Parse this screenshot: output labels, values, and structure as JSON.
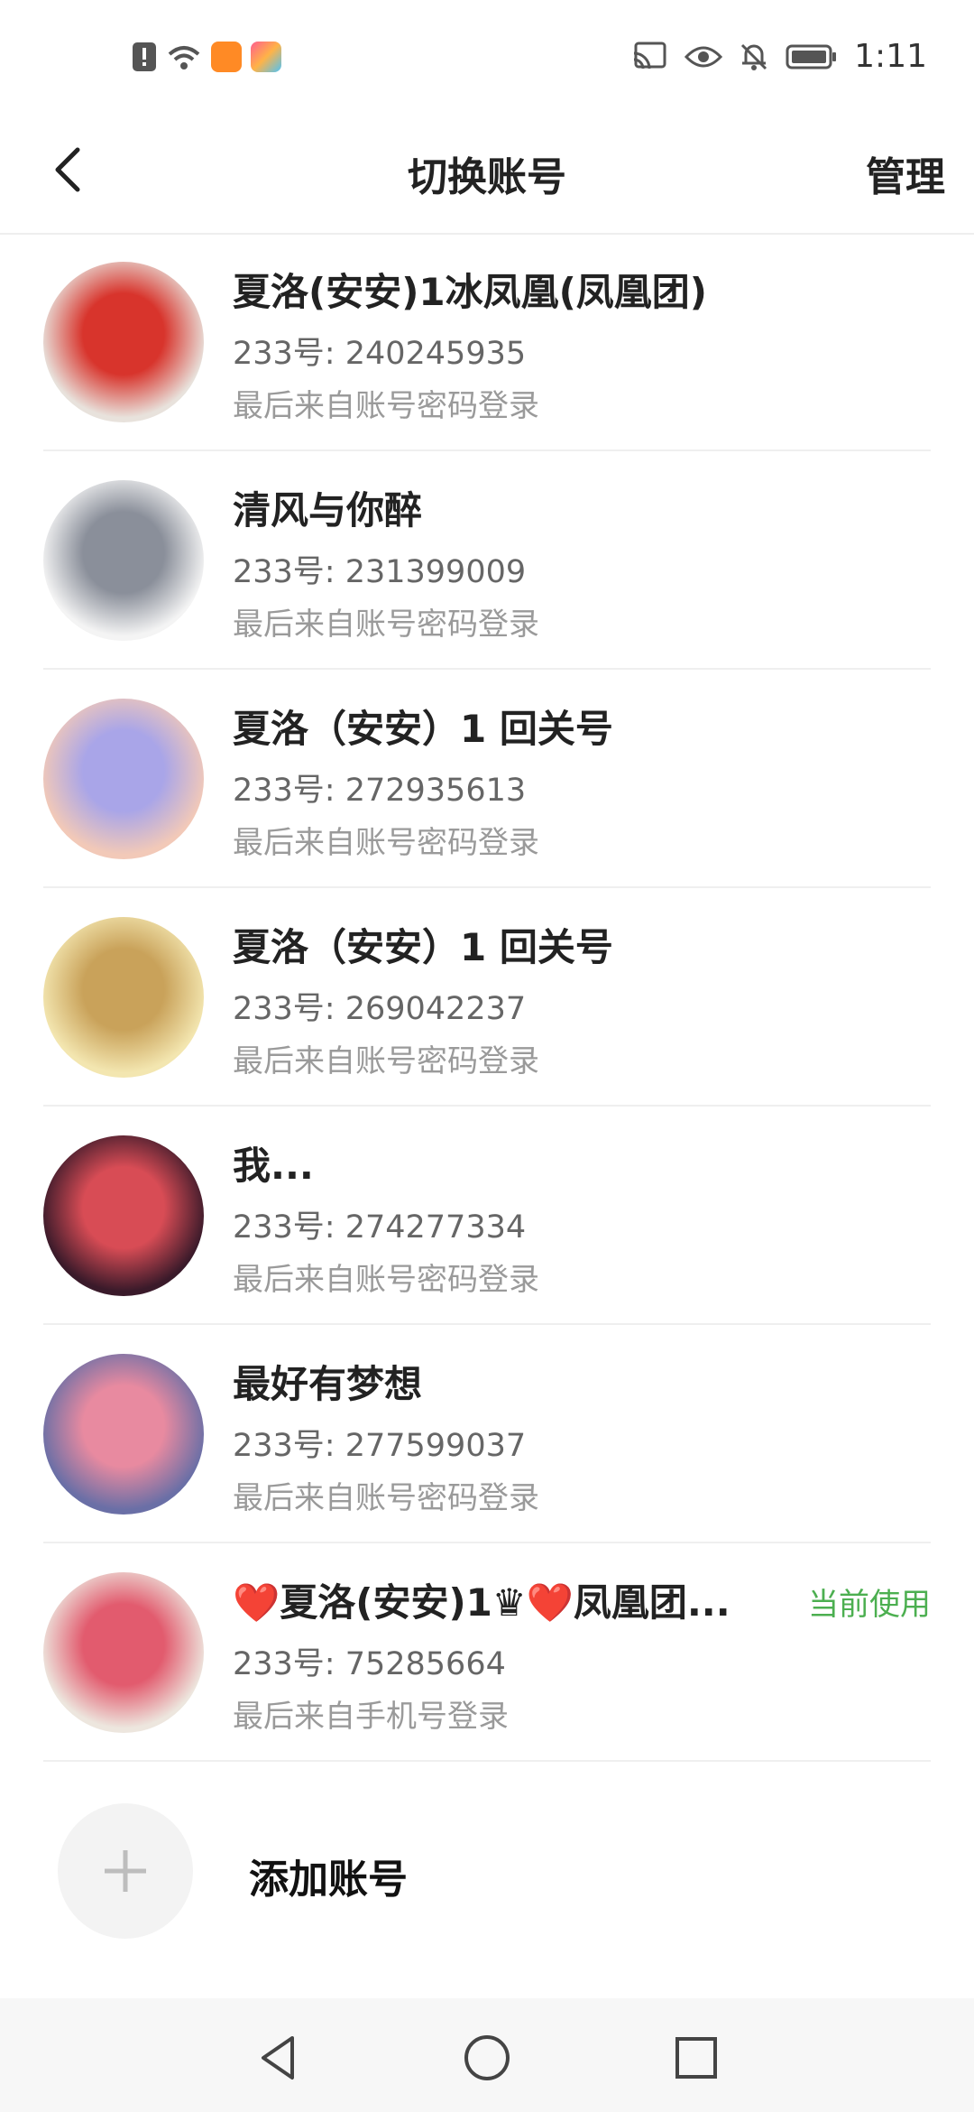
{
  "status_bar": {
    "time": "1:11",
    "left_icons": [
      "alert-icon",
      "wifi-icon",
      "video-app-icon",
      "store-app-icon"
    ],
    "right_icons": [
      "cast-icon",
      "eye-icon",
      "bell-off-icon",
      "battery-icon"
    ]
  },
  "header": {
    "title": "切换账号",
    "manage_label": "管理"
  },
  "accounts": [
    {
      "name": "夏洛(安安)1冰凤凰(凤凰团)",
      "uid": "233号: 240245935",
      "login": "最后来自账号密码登录",
      "avatar_colors": [
        "#e8e2dc",
        "#d8342c"
      ]
    },
    {
      "name": "清风与你醉",
      "uid": "233号: 231399009",
      "login": "最后来自账号密码登录",
      "avatar_colors": [
        "#f4f4f4",
        "#8a8f9a"
      ]
    },
    {
      "name": "夏洛（安安）1 回关号",
      "uid": "233号: 272935613",
      "login": "最后来自账号密码登录",
      "avatar_colors": [
        "#f2c9b8",
        "#a9a5e8"
      ]
    },
    {
      "name": "夏洛（安安）1   回关号",
      "uid": "233号: 269042237",
      "login": "最后来自账号密码登录",
      "avatar_colors": [
        "#f3e6b0",
        "#c9a25a"
      ]
    },
    {
      "name": "我...",
      "uid": "233号: 274277334",
      "login": "最后来自账号密码登录",
      "avatar_colors": [
        "#3a1a2a",
        "#d84c55"
      ]
    },
    {
      "name": "最好有梦想",
      "uid": "233号: 277599037",
      "login": "最后来自账号密码登录",
      "avatar_colors": [
        "#6a6fa6",
        "#e88aa0"
      ]
    },
    {
      "name": "❤️夏洛(安安)1♛❤️凤凰团...",
      "uid": "233号: 75285664",
      "login": "最后来自手机号登录",
      "avatar_colors": [
        "#ede6de",
        "#e25b6e"
      ]
    }
  ],
  "current_label": "当前使用",
  "current_index": 6,
  "add_account": {
    "label": "添加账号"
  },
  "nav": [
    "back-triangle-icon",
    "home-circle-icon",
    "recents-square-icon"
  ],
  "colors": {
    "accent_green": "#4caf50",
    "divider": "#efefef"
  }
}
